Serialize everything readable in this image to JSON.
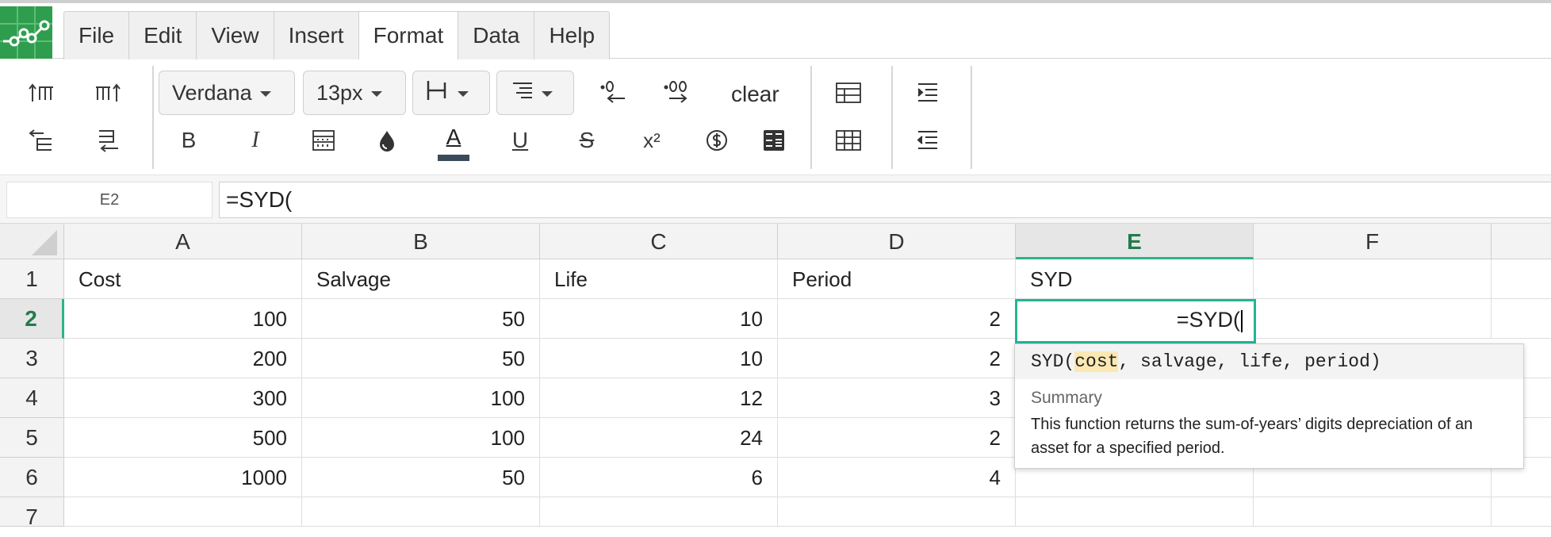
{
  "menu": {
    "items": [
      "File",
      "Edit",
      "View",
      "Insert",
      "Format",
      "Data",
      "Help"
    ],
    "active": "Format"
  },
  "toolbar": {
    "font_family": "Verdana",
    "font_size": "13px",
    "clear_label": "clear",
    "bold_label": "B",
    "italic_label": "I",
    "underline_label": "U",
    "strike_label": "S",
    "text_color_label": "A",
    "superscript_label": "x²",
    "text_color_swatch": "#3b4a5a"
  },
  "formula_bar": {
    "cell_ref": "E2",
    "formula": "=SYD("
  },
  "grid": {
    "columns": [
      "A",
      "B",
      "C",
      "D",
      "E",
      "F"
    ],
    "selected_column": "E",
    "rows": [
      "1",
      "2",
      "3",
      "4",
      "5",
      "6",
      "7"
    ],
    "selected_row": "2",
    "header_row": [
      "Cost",
      "Salvage",
      "Life",
      "Period",
      "SYD",
      ""
    ],
    "data": [
      [
        "100",
        "50",
        "10",
        "2"
      ],
      [
        "200",
        "50",
        "10",
        "2"
      ],
      [
        "300",
        "100",
        "12",
        "3"
      ],
      [
        "500",
        "100",
        "24",
        "2"
      ],
      [
        "1000",
        "50",
        "6",
        "4"
      ]
    ],
    "active_cell_value": "=SYD("
  },
  "function_hint": {
    "name": "SYD(",
    "current_arg": "cost",
    "rest_args": ", salvage, life, period)",
    "summary_label": "Summary",
    "summary_text": "This function returns the sum-of-years’ digits depreciation of an asset for a specified period."
  },
  "colors": {
    "accent": "#25b497",
    "logo": "#2e9e4e",
    "selected_header_text": "#237b4b",
    "arg_highlight": "#fbe8b3"
  }
}
